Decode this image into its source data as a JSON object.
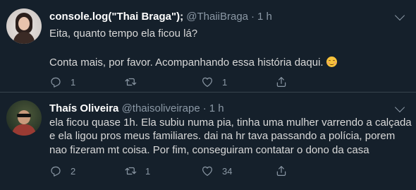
{
  "tweets": [
    {
      "display_name": "console.log(\"Thai Braga\");",
      "handle": "@ThaiiBraga",
      "separator": "·",
      "time": "1 h",
      "lines": [
        "Eita, quanto tempo ela ficou lá?",
        "Conta mais, por favor. Acompanhando essa história daqui."
      ],
      "emoji": "smiling-face-icon",
      "reply_count": "1",
      "retweet_count": "",
      "like_count": "1"
    },
    {
      "display_name": "Thaís Oliveira",
      "handle": "@thaisoliveirape",
      "separator": "·",
      "time": "1 h",
      "lines": [
        "ela ficou quase 1h. Ela subiu numa pia, tinha uma mulher varrendo a calçada",
        "e ela ligou pros meus familiares. dai na hr tava passando a polícia, porem",
        "nao fizeram mt coisa. Por fim, conseguiram contatar o dono da casa",
        ""
      ],
      "reply_count": "2",
      "retweet_count": "1",
      "like_count": "34"
    }
  ],
  "colors": {
    "background": "#15202b",
    "text": "#d9d9d9",
    "secondary": "#8b98a5",
    "divider": "#38444d"
  }
}
